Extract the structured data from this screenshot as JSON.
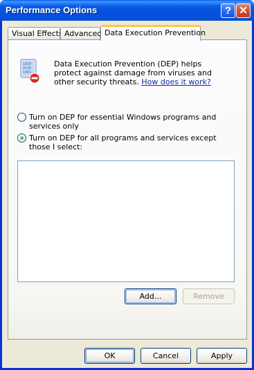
{
  "window": {
    "title": "Performance Options",
    "help_label": "?",
    "close_label": "✕"
  },
  "tabs": [
    {
      "label": "Visual Effects",
      "active": false
    },
    {
      "label": "Advanced",
      "active": false
    },
    {
      "label": "Data Execution Prevention",
      "active": true
    }
  ],
  "dep": {
    "icon": "dep-shield-binary-icon",
    "description": "Data Execution Prevention (DEP) helps protect against damage from viruses and other security threats.",
    "link_text": "How does it work?"
  },
  "options": [
    {
      "label": "Turn on DEP for essential Windows programs and services only",
      "selected": false
    },
    {
      "label": "Turn on DEP for all programs and services except those I select:",
      "selected": true
    }
  ],
  "exceptions_list": [],
  "buttons": {
    "add": "Add...",
    "remove": "Remove",
    "ok": "OK",
    "cancel": "Cancel",
    "apply": "Apply"
  },
  "colors": {
    "titlebar": "#0a5ce6",
    "dialog_face": "#ece9d8",
    "link": "#0b2fa8",
    "active_tab_accent": "#ffc83c"
  }
}
